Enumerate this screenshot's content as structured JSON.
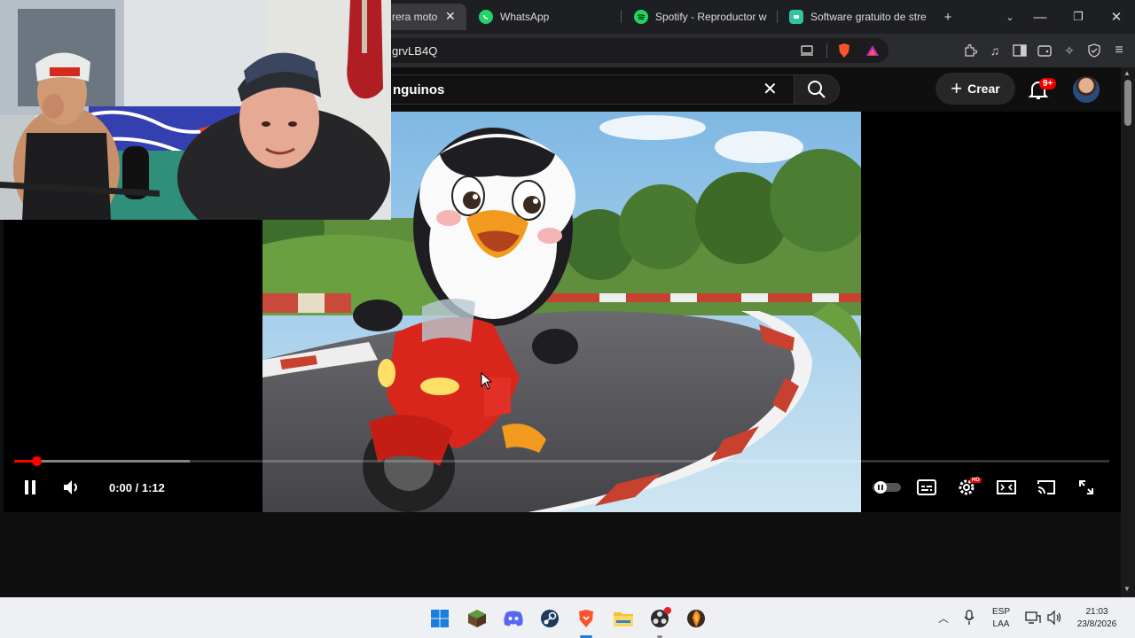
{
  "browser": {
    "tabs": [
      {
        "label": "rera moto",
        "icon": "youtube-icon",
        "active": true
      },
      {
        "label": "WhatsApp",
        "icon": "whatsapp-icon"
      },
      {
        "label": "Spotify - Reproductor web",
        "icon": "spotify-icon"
      },
      {
        "label": "Software gratuito de stre",
        "icon": "streamlabs-icon"
      }
    ],
    "new_tab_label": "+",
    "address": "grvLB4Q",
    "colors": {
      "tabstrip": "#1e1f22",
      "toolbar": "#2b2c2f",
      "active_tab": "#3b3b3d"
    }
  },
  "youtube": {
    "search_value": "nguinos",
    "create_label": "Crear",
    "notification_count": "9+",
    "accent": "#ff0000"
  },
  "player": {
    "time": "0:00 / 1:12",
    "played_fraction": 0.02,
    "buffered_fraction": 0.16,
    "controls": [
      "pause-icon",
      "volume-icon",
      "autoplay-toggle",
      "subtitles-icon",
      "settings-icon",
      "theater-icon",
      "cast-icon",
      "fullscreen-icon"
    ],
    "settings_badge": "HD"
  },
  "taskbar": {
    "apps": [
      "windows-start-icon",
      "minecraft-icon",
      "discord-icon",
      "steam-icon",
      "brave-icon",
      "file-explorer-icon",
      "obs-icon",
      "fl-studio-icon"
    ],
    "language": "ESP",
    "layout": "LAA",
    "time": "21:03",
    "date": "23/8/2026"
  }
}
